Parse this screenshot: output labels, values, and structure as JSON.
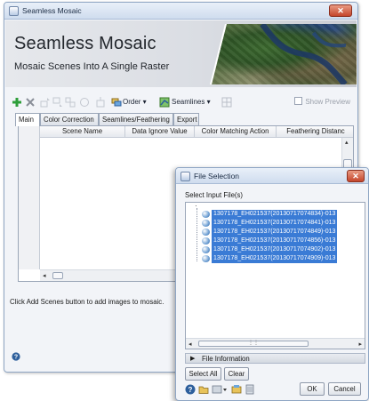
{
  "main_window": {
    "title": "Seamless Mosaic",
    "close_label": "✕",
    "banner": {
      "heading": "Seamless Mosaic",
      "subheading": "Mosaic Scenes Into A Single Raster"
    },
    "toolbar": {
      "order_label": "Order ▾",
      "seamlines_label": "Seamlines ▾",
      "show_preview_label": "Show Preview"
    },
    "tabs": [
      {
        "label": "Main",
        "active": true
      },
      {
        "label": "Color Correction",
        "active": false
      },
      {
        "label": "Seamlines/Feathering",
        "active": false
      },
      {
        "label": "Export",
        "active": false
      }
    ],
    "table": {
      "columns": [
        "Scene Name",
        "Data Ignore Value",
        "Color Matching Action",
        "Feathering Distanc"
      ]
    },
    "status_text": "Click Add Scenes button to add images to mosaic."
  },
  "file_dialog": {
    "title": "File Selection",
    "close_label": "✕",
    "select_label": "Select Input File(s)",
    "files": [
      "1307178_EH021537(20130717074834)-013",
      "1307178_EH021537(20130717074841)-013",
      "1307178_EH021537(20130717074849)-013",
      "1307178_EH021537(20130717074856)-013",
      "1307178_EH021537(20130717074902)-013",
      "1307178_EH021537(20130717074909)-013"
    ],
    "file_information_label": "File Information",
    "select_all_label": "Select All",
    "clear_label": "Clear",
    "ok_label": "OK",
    "cancel_label": "Cancel"
  },
  "colors": {
    "selection": "#3a7bd5",
    "close_button": "#c4452b",
    "add_icon": "#2e9e3a",
    "remove_icon": "#8a8f99"
  }
}
